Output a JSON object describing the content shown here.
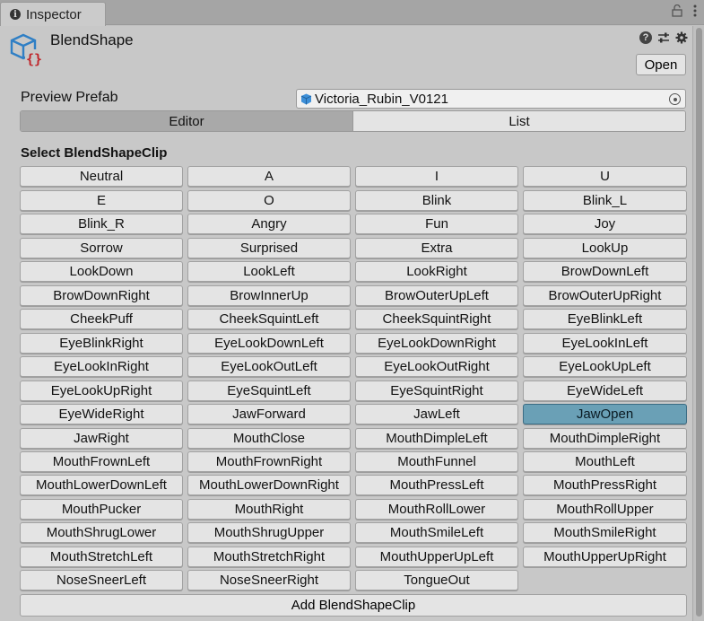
{
  "window": {
    "tab_label": "Inspector",
    "tab_icon": "info-icon"
  },
  "component": {
    "title": "BlendShape",
    "icon": "script-cube-icon",
    "open_label": "Open"
  },
  "prefab": {
    "label": "Preview Prefab",
    "value": "Victoria_Rubin_V0121"
  },
  "toolbar": {
    "tabs": [
      {
        "label": "Editor",
        "active": true
      },
      {
        "label": "List",
        "active": false
      }
    ]
  },
  "section": {
    "title": "Select BlendShapeClip"
  },
  "clips": [
    "Neutral",
    "A",
    "I",
    "U",
    "E",
    "O",
    "Blink",
    "Blink_L",
    "Blink_R",
    "Angry",
    "Fun",
    "Joy",
    "Sorrow",
    "Surprised",
    "Extra",
    "LookUp",
    "LookDown",
    "LookLeft",
    "LookRight",
    "BrowDownLeft",
    "BrowDownRight",
    "BrowInnerUp",
    "BrowOuterUpLeft",
    "BrowOuterUpRight",
    "CheekPuff",
    "CheekSquintLeft",
    "CheekSquintRight",
    "EyeBlinkLeft",
    "EyeBlinkRight",
    "EyeLookDownLeft",
    "EyeLookDownRight",
    "EyeLookInLeft",
    "EyeLookInRight",
    "EyeLookOutLeft",
    "EyeLookOutRight",
    "EyeLookUpLeft",
    "EyeLookUpRight",
    "EyeSquintLeft",
    "EyeSquintRight",
    "EyeWideLeft",
    "EyeWideRight",
    "JawForward",
    "JawLeft",
    "JawOpen",
    "JawRight",
    "MouthClose",
    "MouthDimpleLeft",
    "MouthDimpleRight",
    "MouthFrownLeft",
    "MouthFrownRight",
    "MouthFunnel",
    "MouthLeft",
    "MouthLowerDownLeft",
    "MouthLowerDownRight",
    "MouthPressLeft",
    "MouthPressRight",
    "MouthPucker",
    "MouthRight",
    "MouthRollLower",
    "MouthRollUpper",
    "MouthShrugLower",
    "MouthShrugUpper",
    "MouthSmileLeft",
    "MouthSmileRight",
    "MouthStretchLeft",
    "MouthStretchRight",
    "MouthUpperUpLeft",
    "MouthUpperUpRight",
    "NoseSneerLeft",
    "NoseSneerRight",
    "TongueOut"
  ],
  "selected_clip": "JawOpen",
  "add_button": {
    "label": "Add BlendShapeClip"
  },
  "colors": {
    "selected": "#6aa0b6",
    "button": "#e4e4e4",
    "panel": "#c8c8c8"
  }
}
